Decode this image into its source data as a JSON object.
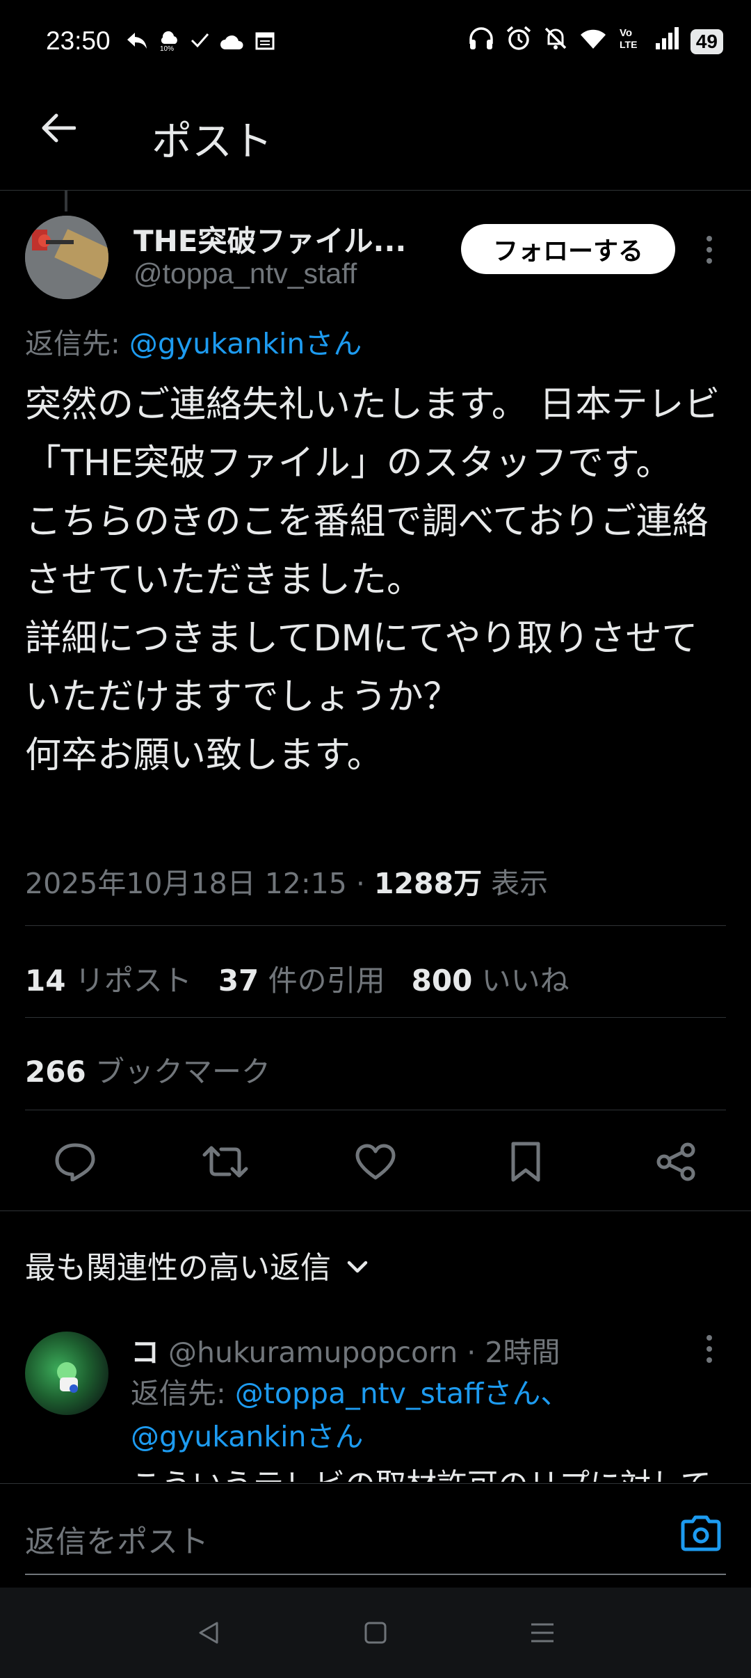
{
  "status_bar": {
    "time": "23:50",
    "battery": "49",
    "left_icons": [
      "reply-arrow-icon",
      "weather-icon",
      "check-icon",
      "cloud-icon",
      "calendar-icon"
    ],
    "right_icons": [
      "headphones-icon",
      "alarm-icon",
      "mute-icon",
      "wifi-icon",
      "volte-icon",
      "signal-icon",
      "battery-icon"
    ]
  },
  "header": {
    "title": "ポスト"
  },
  "tweet": {
    "author_name": "THE突破ファイル...",
    "author_handle": "@toppa_ntv_staff",
    "follow_label": "フォローする",
    "reply_to_prefix": "返信先: ",
    "reply_to_handle": "@gyukankinさん",
    "body": "突然のご連絡失礼いたします。 日本テレビ「THE突破ファイル」のスタッフです。\nこちらのきのこを番組で調べておりご連絡させていただきました。\n詳細につきましてDMにてやり取りさせていただけますでしょうか？\n何卒お願い致します。",
    "timestamp": "2025年10月18日 12:15 · ",
    "views_count": "1288万",
    "views_label": " 表示",
    "reposts_count": "14",
    "reposts_label": " リポスト",
    "quotes_count": "37",
    "quotes_label": " 件の引用",
    "likes_count": "800",
    "likes_label": " いいね",
    "bookmarks_count": "266",
    "bookmarks_label": " ブックマーク"
  },
  "actions": [
    "reply-icon",
    "retweet-icon",
    "like-icon",
    "bookmark-icon",
    "share-icon"
  ],
  "sort": {
    "label": "最も関連性の高い返信"
  },
  "reply": {
    "name": "コ",
    "handle": " @hukuramupopcorn · 2時間",
    "reply_to_prefix": "返信先: ",
    "reply_to_handle1": "@toppa_ntv_staffさん、",
    "reply_to_handle2": "@gyukankinさん",
    "preview": "こういうテレビの取材許可のリプに対して"
  },
  "compose": {
    "placeholder": "返信をポスト"
  },
  "colors": {
    "background": "#000000",
    "text": "#e7e9ea",
    "secondary_text": "#71767b",
    "link": "#1d9bf0",
    "divider": "#2f3336"
  }
}
